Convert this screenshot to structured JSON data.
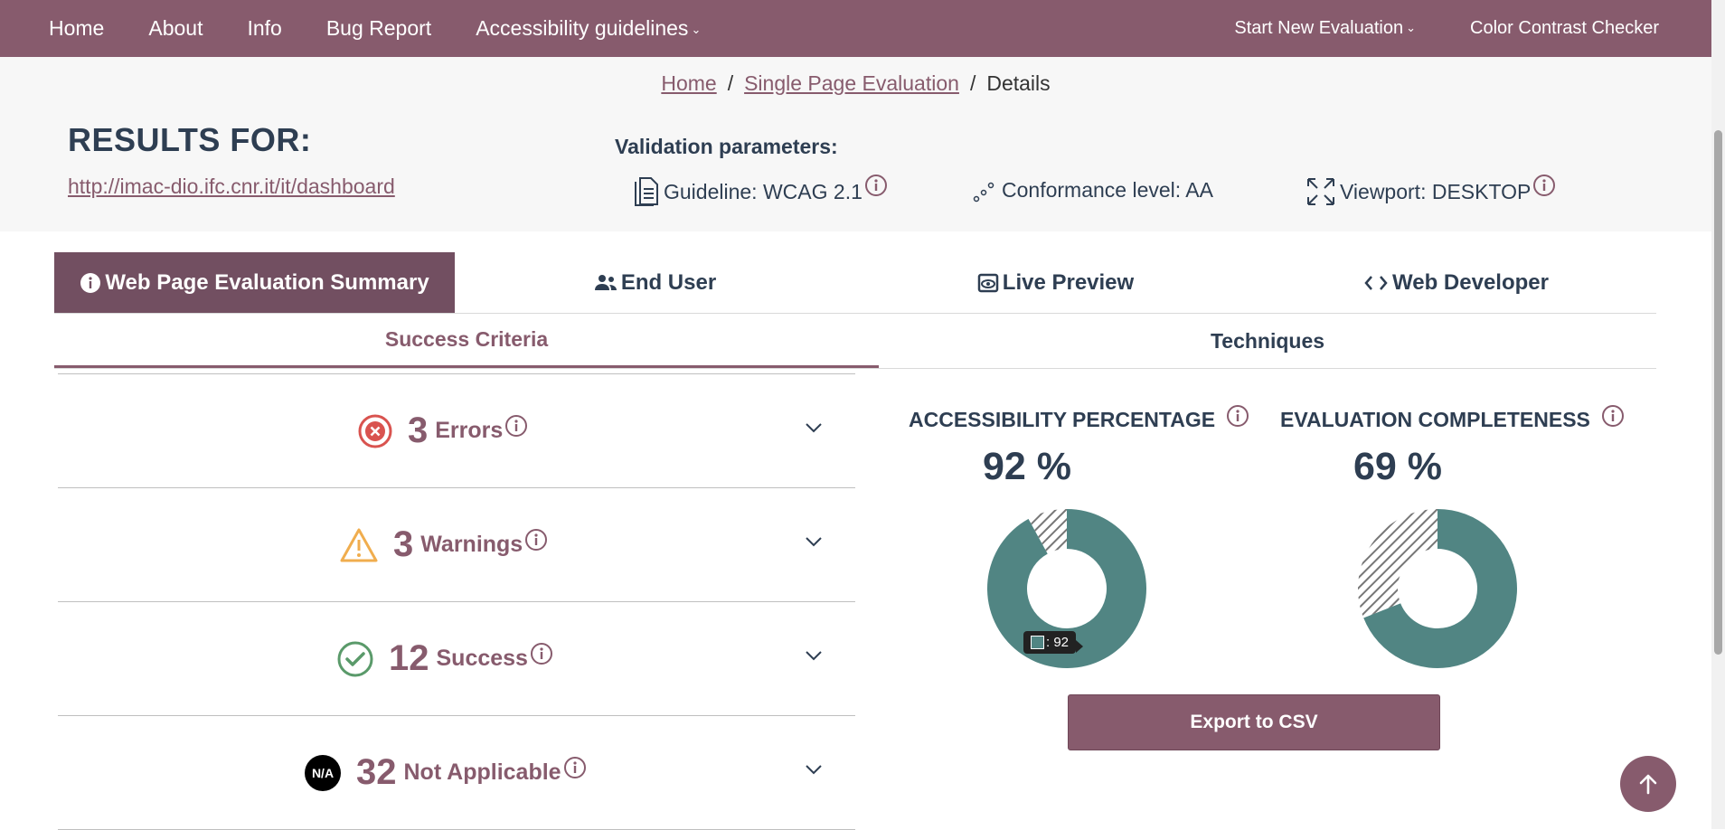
{
  "nav": {
    "left": [
      "Home",
      "About",
      "Info",
      "Bug Report",
      "Accessibility guidelines"
    ],
    "right": [
      "Start New Evaluation",
      "Color Contrast Checker"
    ]
  },
  "breadcrumb": {
    "home": "Home",
    "single": "Single Page Evaluation",
    "current": "Details"
  },
  "results": {
    "title": "RESULTS FOR:",
    "url": "http://imac-dio.ifc.cnr.it/it/dashboard"
  },
  "validation": {
    "title": "Validation parameters:",
    "guideline": "Guideline: WCAG 2.1",
    "conformance": "Conformance level: AA",
    "viewport": "Viewport: DESKTOP"
  },
  "tabs": [
    "Web Page Evaluation Summary",
    "End User",
    "Live Preview",
    "Web Developer"
  ],
  "subtabs": [
    "Success Criteria",
    "Techniques"
  ],
  "criteria": [
    {
      "count": "3",
      "label": "Errors"
    },
    {
      "count": "3",
      "label": "Warnings"
    },
    {
      "count": "12",
      "label": "Success"
    },
    {
      "count": "32",
      "label": "Not Applicable",
      "badge": "N/A"
    }
  ],
  "metrics": {
    "accessibility": {
      "title": "ACCESSIBILITY PERCENTAGE",
      "value": "92 %",
      "percent": 92
    },
    "completeness": {
      "title": "EVALUATION COMPLETENESS",
      "value": "69 %",
      "percent": 69
    }
  },
  "tooltip": ": 92",
  "export_label": "Export to CSV",
  "colors": {
    "brand": "#875b6d",
    "brand_dark": "#724f61",
    "teal": "#518583",
    "text": "#2e3e52",
    "error": "#d9534f",
    "warning": "#f0ad4e",
    "success": "#5a9a6a"
  }
}
